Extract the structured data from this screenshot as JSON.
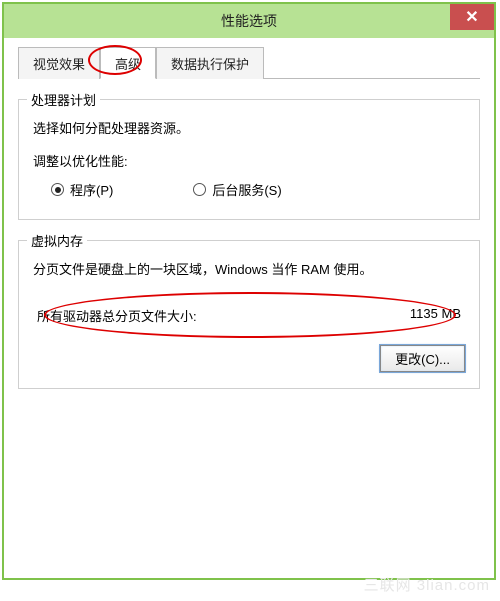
{
  "window": {
    "title": "性能选项",
    "close_glyph": "✕"
  },
  "tabs": {
    "visual": "视觉效果",
    "advanced": "高级",
    "dep": "数据执行保护"
  },
  "processor": {
    "legend": "处理器计划",
    "desc": "选择如何分配处理器资源。",
    "adjust_label": "调整以优化性能:",
    "opt_programs": "程序(P)",
    "opt_services": "后台服务(S)"
  },
  "vm": {
    "legend": "虚拟内存",
    "desc": "分页文件是硬盘上的一块区域，Windows 当作 RAM 使用。",
    "total_label": "所有驱动器总分页文件大小:",
    "total_value": "1135 MB",
    "change_btn": "更改(C)..."
  },
  "watermark": "三联网 3lian.com"
}
